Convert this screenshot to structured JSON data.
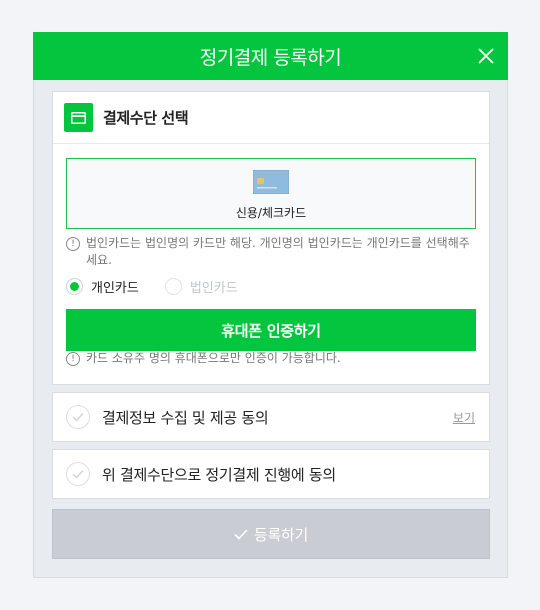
{
  "modal": {
    "title": "정기결제 등록하기",
    "close_icon": "close-icon",
    "accent_color": "#03c63e"
  },
  "payment": {
    "section_title": "결제수단 선택",
    "section_icon": "credit-card-icon",
    "method_label": "신용/체크카드",
    "method_icon": "card-image-icon",
    "notice": "법인카드는 법인명의 카드만 해당. 개인명의 법인카드는 개인카드를 선택해주세요.",
    "radios": [
      {
        "label": "개인카드",
        "selected": true,
        "enabled": true
      },
      {
        "label": "법인카드",
        "selected": false,
        "enabled": false
      }
    ],
    "verify_button": "휴대폰 인증하기",
    "verify_notice": "카드 소유주 명의 휴대폰으로만 인증이 가능합니다."
  },
  "agreements": [
    {
      "label": "결제정보 수집 및 제공 동의",
      "link": "보기"
    },
    {
      "label": "위 결제수단으로 정기결제 진행에 동의"
    }
  ],
  "submit": {
    "label": "등록하기",
    "icon": "checkmark-icon"
  }
}
